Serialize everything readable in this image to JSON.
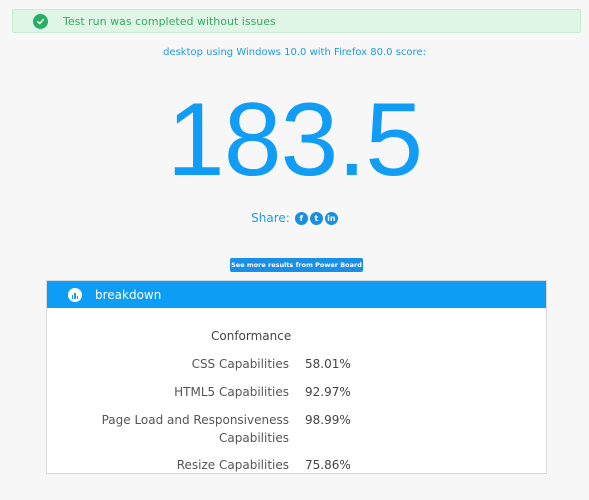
{
  "alert": {
    "message": "Test run was completed without issues",
    "icon": "check-circle-icon",
    "color": "#27b062"
  },
  "subtitle": "desktop using Windows 10.0 with Firefox 80.0 score:",
  "score": "183.5",
  "share": {
    "label": "Share:",
    "icons": [
      "facebook-icon",
      "twitter-icon",
      "linkedin-icon"
    ],
    "glyphs": {
      "facebook": "f",
      "twitter": "t",
      "linkedin": "in"
    }
  },
  "more_button": "See more results from Power Board",
  "breakdown": {
    "title": "breakdown",
    "icon": "bar-chart-icon",
    "section_title": "Conformance",
    "rows": [
      {
        "label": "CSS Capabilities",
        "value": "58.01%"
      },
      {
        "label": "HTML5 Capabilities",
        "value": "92.97%"
      },
      {
        "label": "Page Load and Responsiveness Capabilities",
        "value": "98.99%"
      },
      {
        "label": "Resize Capabilities",
        "value": "75.86%"
      }
    ]
  },
  "colors": {
    "accent": "#119df5",
    "header": "#0d9df5",
    "success_bg": "#dff5e6"
  }
}
